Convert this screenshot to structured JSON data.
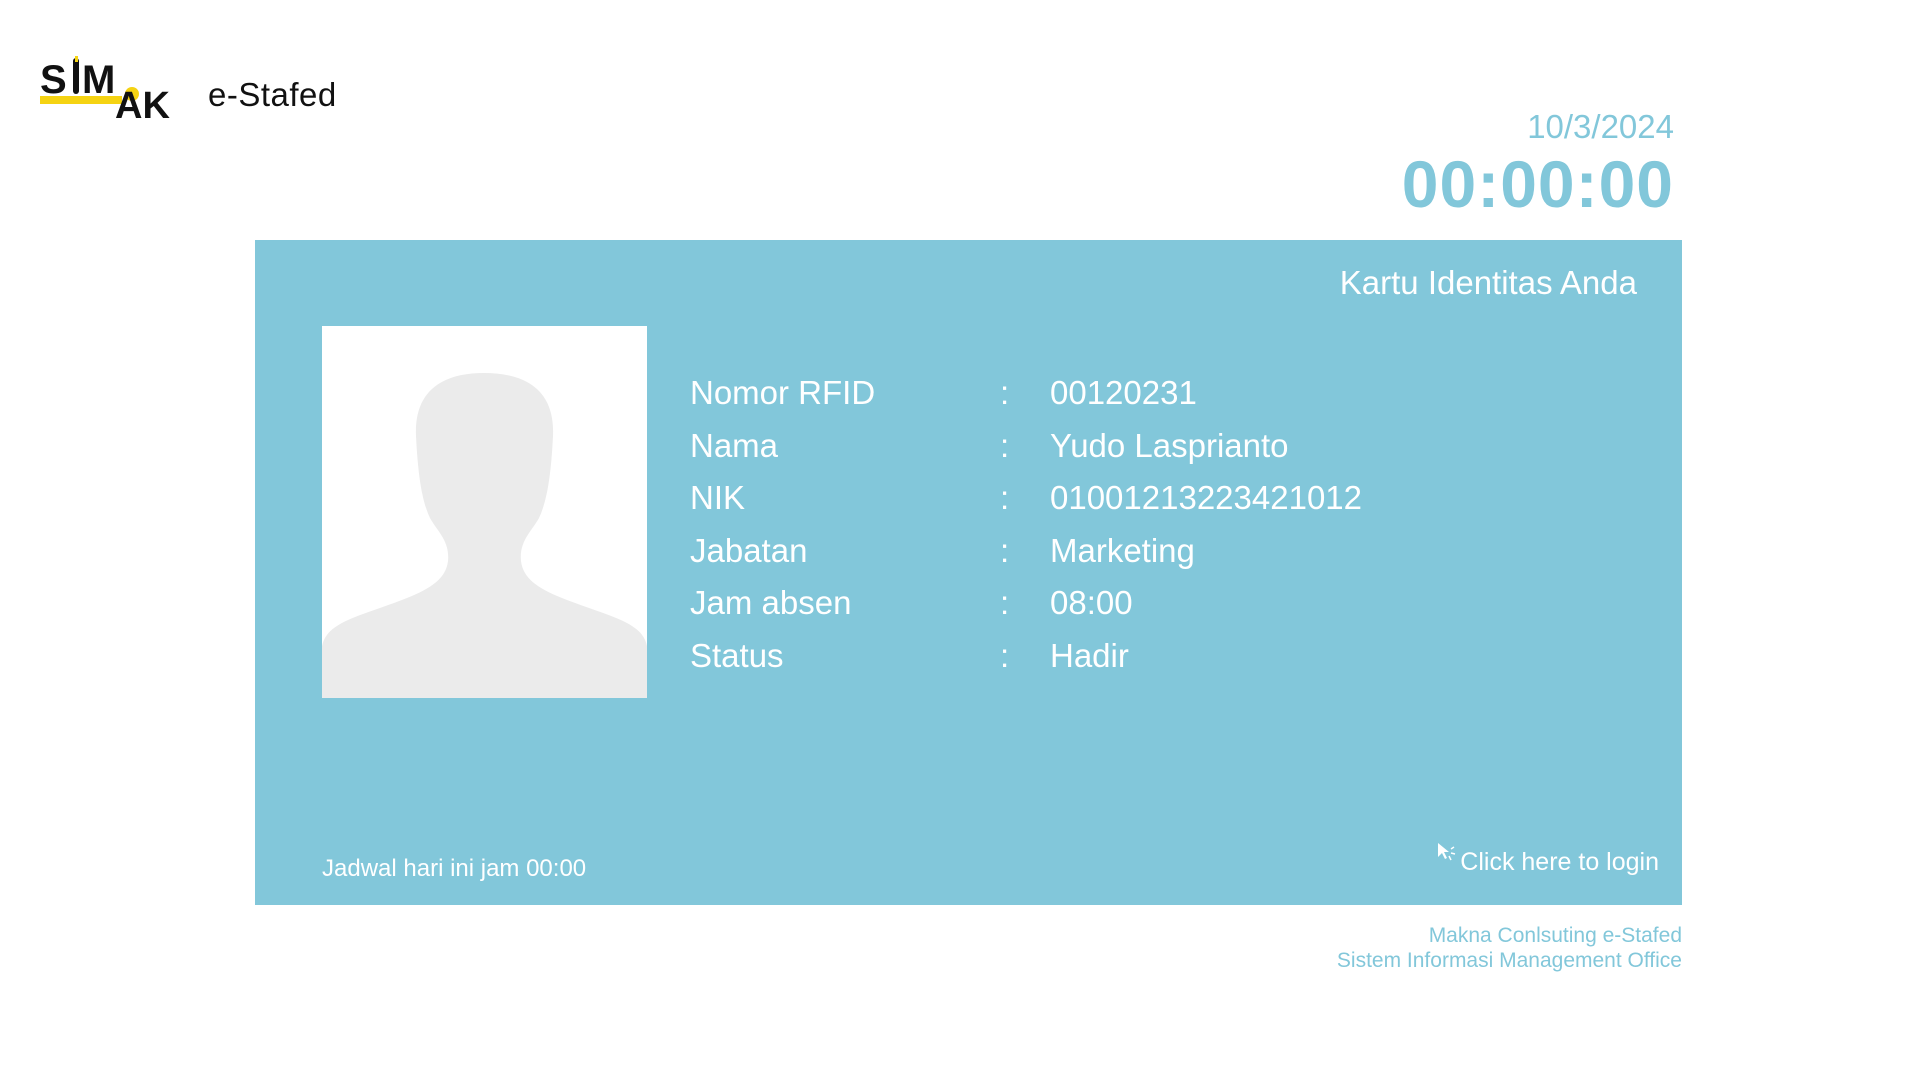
{
  "header": {
    "logo_text": "SIMAK",
    "app_name": "e-Stafed"
  },
  "clock": {
    "date": "10/3/2024",
    "time": "00:00:00"
  },
  "card": {
    "title": "Kartu Identitas Anda",
    "rows": [
      {
        "label": "Nomor RFID",
        "sep": ":",
        "value": "00120231"
      },
      {
        "label": "Nama",
        "sep": ":",
        "value": "Yudo Lasprianto"
      },
      {
        "label": "NIK",
        "sep": ":",
        "value": "01001213223421012"
      },
      {
        "label": "Jabatan",
        "sep": ":",
        "value": "Marketing"
      },
      {
        "label": "Jam absen",
        "sep": ":",
        "value": "08:00"
      },
      {
        "label": "Status",
        "sep": ":",
        "value": "Hadir"
      }
    ],
    "schedule": "Jadwal hari ini jam 00:00",
    "login_label": "Click here to login"
  },
  "footer": {
    "line1": "Makna Conlsuting e-Stafed",
    "line2": "Sistem Informasi Management Office"
  },
  "colors": {
    "accent": "#82c7da",
    "logo_yellow": "#f5d312",
    "photo_placeholder": "#ebebeb"
  }
}
